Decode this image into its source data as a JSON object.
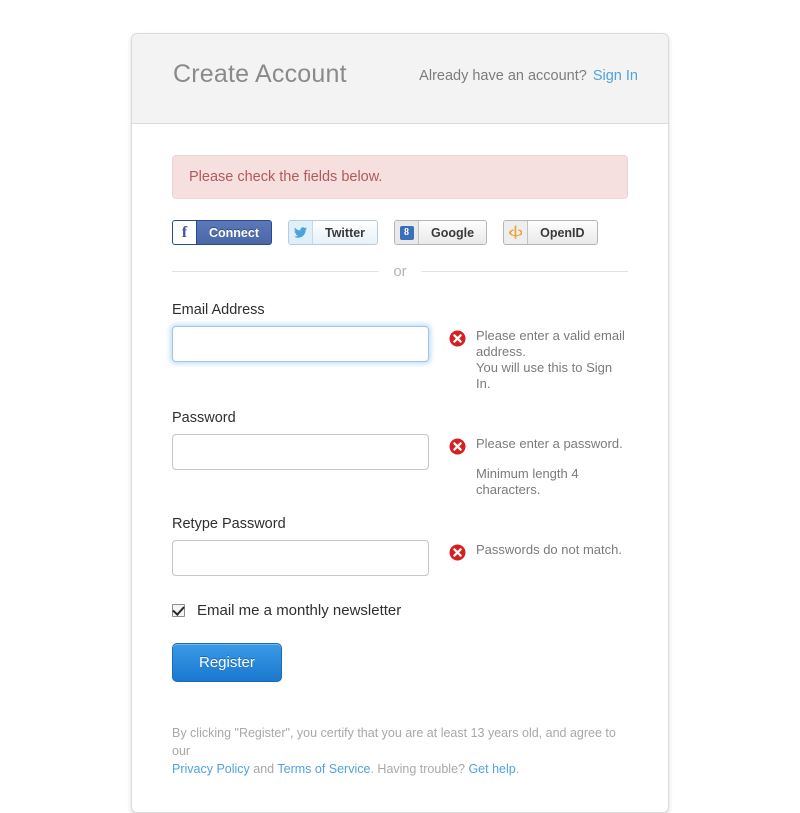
{
  "header": {
    "title": "Create Account",
    "already_text": "Already have an account?",
    "signin_label": "Sign In"
  },
  "alert": {
    "message": "Please check the fields below."
  },
  "social_buttons": [
    {
      "id": "facebook",
      "label": "Connect",
      "icon": "facebook-icon",
      "glyph": "f"
    },
    {
      "id": "twitter",
      "label": "Twitter",
      "icon": "twitter-bird-icon",
      "glyph": "✒"
    },
    {
      "id": "google",
      "label": "Google",
      "icon": "google-icon",
      "glyph": "8"
    },
    {
      "id": "openid",
      "label": "OpenID",
      "icon": "openid-icon",
      "glyph": "⏐"
    }
  ],
  "divider": {
    "text": "or"
  },
  "fields": {
    "email": {
      "label": "Email Address",
      "value": "",
      "placeholder": "",
      "error": "Please enter a valid email address.",
      "hint": "You will use this to Sign In.",
      "focused": true
    },
    "password": {
      "label": "Password",
      "value": "",
      "placeholder": "",
      "error": "Please enter a password.",
      "hint": "Minimum length 4 characters.",
      "focused": false
    },
    "retype_password": {
      "label": "Retype Password",
      "value": "",
      "placeholder": "",
      "error": "Passwords do not match.",
      "hint": "",
      "focused": false
    }
  },
  "newsletter": {
    "label": "Email me a monthly newsletter",
    "checked": true
  },
  "submit": {
    "label": "Register"
  },
  "legal": {
    "line1": "By clicking \"Register\", you certify that you are at least 13 years old, and agree to our",
    "privacy_label": "Privacy Policy",
    "and_text": " and ",
    "terms_label": "Terms of Service",
    "trouble_text": ". Having trouble? ",
    "help_label": "Get help",
    "period": "."
  },
  "colors": {
    "link": "#4fa3dd",
    "alert_bg": "#f6dfdf",
    "alert_text": "#b35a5a",
    "error_icon": "#d61f1f",
    "primary_button": "#1a78cf",
    "header_bg": "#f3f3f3"
  }
}
